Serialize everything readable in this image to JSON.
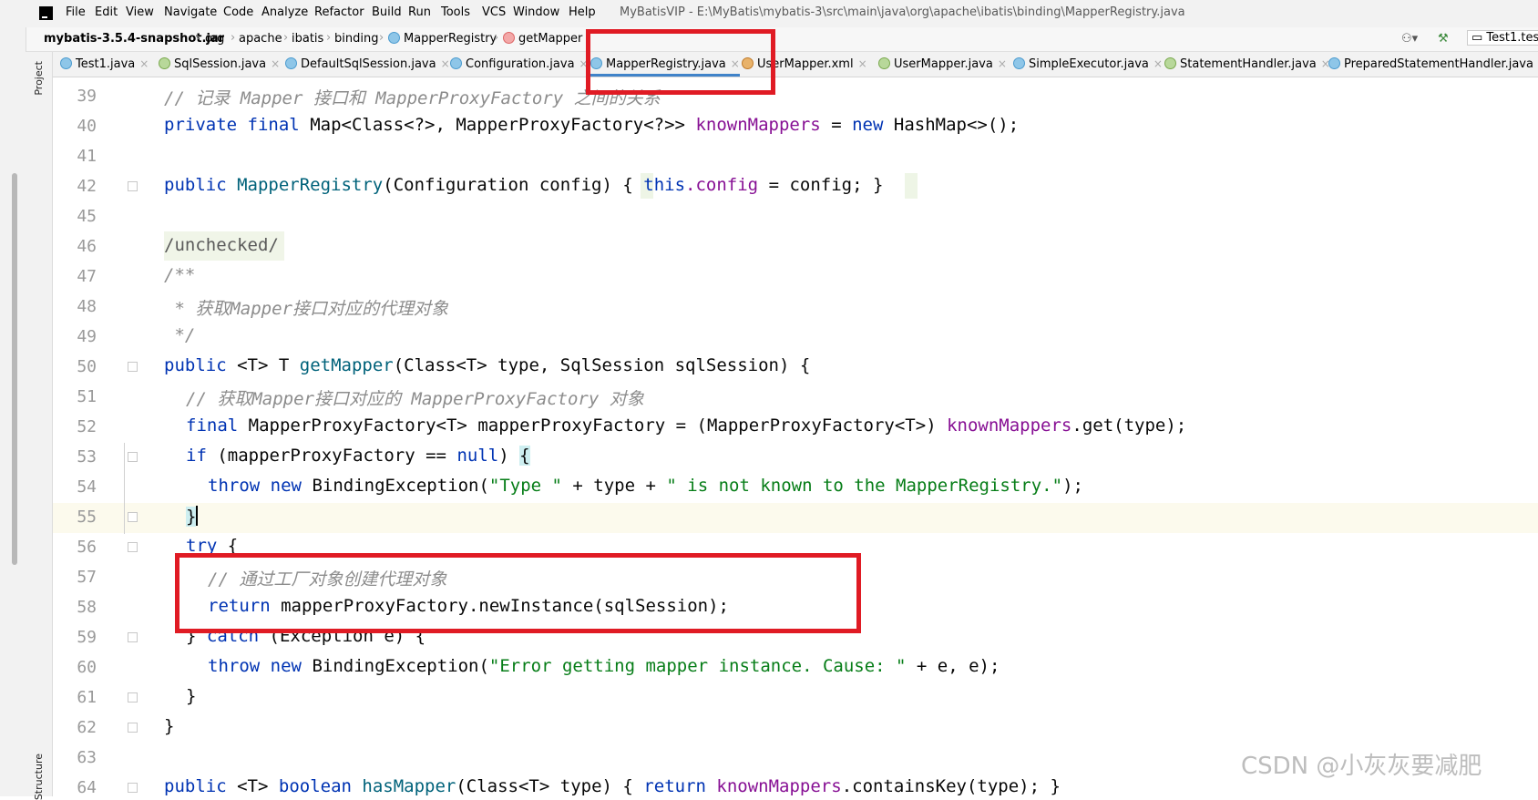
{
  "menu": {
    "items": [
      "File",
      "Edit",
      "View",
      "Navigate",
      "Code",
      "Analyze",
      "Refactor",
      "Build",
      "Run",
      "Tools",
      "VCS",
      "Window",
      "Help"
    ],
    "window_title": "MyBatisVIP - E:\\MyBatis\\mybatis-3\\src\\main\\java\\org\\apache\\ibatis\\binding\\MapperRegistry.java"
  },
  "breadcrumb": {
    "items": [
      "mybatis-3.5.4-snapshot.jar",
      "org",
      "apache",
      "ibatis",
      "binding",
      "MapperRegistry",
      "getMapper"
    ],
    "run_config": "Test1.tes"
  },
  "tabs": [
    {
      "label": "Test1.java",
      "icon": "class-icon"
    },
    {
      "label": "SqlSession.java",
      "icon": "interface-icon"
    },
    {
      "label": "DefaultSqlSession.java",
      "icon": "class-icon"
    },
    {
      "label": "Configuration.java",
      "icon": "class-icon"
    },
    {
      "label": "MapperRegistry.java",
      "icon": "class-icon",
      "active": true
    },
    {
      "label": "UserMapper.xml",
      "icon": "xml-icon"
    },
    {
      "label": "UserMapper.java",
      "icon": "interface-icon"
    },
    {
      "label": "SimpleExecutor.java",
      "icon": "class-icon"
    },
    {
      "label": "StatementHandler.java",
      "icon": "interface-icon"
    },
    {
      "label": "PreparedStatementHandler.java",
      "icon": "class-icon"
    }
  ],
  "side_labels": {
    "project": "Project",
    "structure": "Structure"
  },
  "line_numbers": [
    "39",
    "40",
    "41",
    "42",
    "45",
    "46",
    "47",
    "48",
    "49",
    "50",
    "51",
    "52",
    "53",
    "54",
    "55",
    "56",
    "57",
    "58",
    "59",
    "60",
    "61",
    "62",
    "63",
    "64"
  ],
  "code_text": {
    "l39_comment": "// 记录 Mapper 接口和 MapperProxyFactory 之间的关系",
    "l40_kw1": "private",
    "l40_kw2": "final",
    "l40_type": "Map<Class<?>, MapperProxyFactory<?>>",
    "l40_field": "knownMappers",
    "l40_eq": "=",
    "l40_new": "new",
    "l40_rest": "HashMap<>();",
    "l42_kw": "public",
    "l42_fn": "MapperRegistry",
    "l42_params": "(Configuration config)",
    "l42_lbrace": "{",
    "l42_this": "this",
    "l42_field": ".config",
    "l42_rest": " = config;",
    "l42_rbrace": "}",
    "l46_anno": "/unchecked/",
    "l47": "/**",
    "l48": " * 获取Mapper接口对应的代理对象",
    "l49": " */",
    "l50_kw": "public",
    "l50_generic": "<T>",
    "l50_ret": "T",
    "l50_fn": "getMapper",
    "l50_rest": "(Class<T> type, SqlSession sqlSession) {",
    "l51_comment": "// 获取Mapper接口对应的 MapperProxyFactory 对象",
    "l52_kw": "final",
    "l52_mid": "MapperProxyFactory<T> mapperProxyFactory = (MapperProxyFactory<T>)",
    "l52_field": "knownMappers",
    "l52_rest": ".get(type);",
    "l53_kw": "if",
    "l53_mid": "(mapperProxyFactory ==",
    "l53_null": "null",
    "l53_rest": ")",
    "l53_brace": "{",
    "l54_kw1": "throw",
    "l54_kw2": "new",
    "l54_mid": "BindingException(",
    "l54_str1": "\"Type \"",
    "l54_mid2": " + type + ",
    "l54_str2": "\" is not known to the MapperRegistry.\"",
    "l54_rest": ");",
    "l55_brace": "}",
    "l56_kw": "try",
    "l56_rest": " {",
    "l57_comment": "// 通过工厂对象创建代理对象",
    "l58_kw": "return",
    "l58_rest": "mapperProxyFactory.newInstance(sqlSession);",
    "l59_pre": "} ",
    "l59_kw": "catch",
    "l59_rest": " (Exception e) {",
    "l60_kw1": "throw",
    "l60_kw2": "new",
    "l60_mid": "BindingException(",
    "l60_str": "\"Error getting mapper instance. Cause: \"",
    "l60_rest": " + e, e);",
    "l61": "}",
    "l62": "}",
    "l64_kw": "public",
    "l64_generic": "<T>",
    "l64_kw2": "boolean",
    "l64_fn": "hasMapper",
    "l64_params": "(Class<T> type)",
    "l64_lbrace": "{",
    "l64_ret": "return",
    "l64_field": "knownMappers",
    "l64_rest": ".containsKey(type);",
    "l64_rbrace": "}"
  },
  "watermark": "CSDN @小灰灰要减肥",
  "colors": {
    "keyword": "#0033b3",
    "field": "#871094",
    "string": "#067d17",
    "comment": "#8c8c8c",
    "method": "#00627a",
    "highlight": "#e01b24"
  }
}
